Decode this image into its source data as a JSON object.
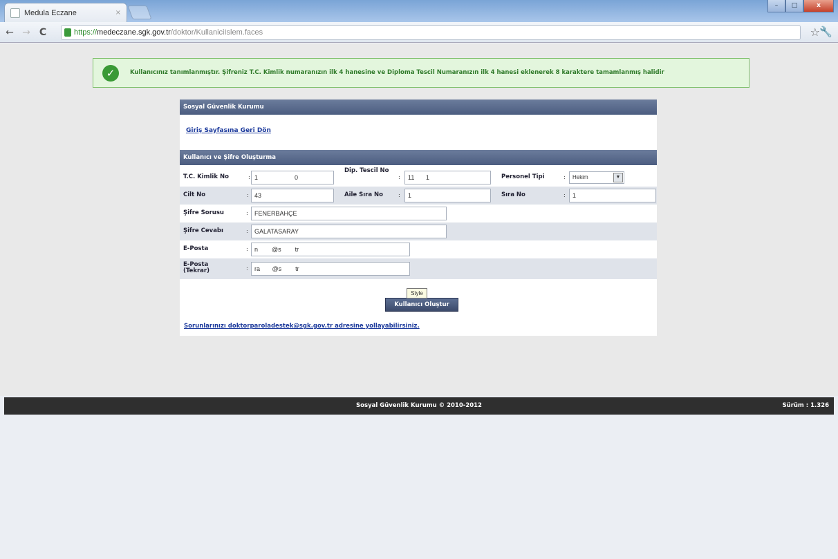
{
  "browser": {
    "tab_title": "Medula Eczane",
    "tab_close": "×",
    "url_scheme": "https://",
    "url_host": "medeczane.sgk.gov.tr",
    "url_path": "/doktor/KullaniciIslem.faces",
    "back": "←",
    "forward": "→",
    "reload": "C",
    "star": "☆",
    "wrench": "🔧",
    "win_min": "–",
    "win_max": "□",
    "win_close": "x"
  },
  "message": {
    "check": "✓",
    "text": "Kullanıcınız tanımlanmıştır. Şifreniz T.C. Kimlik numaranızın ilk 4 hanesine ve Diploma Tescil Numaranızın ilk 4 hanesi eklenerek 8 karaktere tamamlanmış halidir"
  },
  "panel": {
    "header": "Sosyal Güvenlik Kurumu",
    "back_link": "Giriş Sayfasına Geri Dön",
    "section_header": "Kullanıcı ve Şifre Oluşturma"
  },
  "form": {
    "colon": ":",
    "tc_label": "T.C. Kimlik No",
    "tc_value_1": "1",
    "tc_value_2": "0",
    "dip_label": "Dip. Tescil No",
    "dip_value_1": "11",
    "dip_value_2": "1",
    "personel_label": "Personel Tipi",
    "personel_value": "Hekim",
    "cilt_label": "Cilt No",
    "cilt_value": "43",
    "aile_label": "Aile Sıra No",
    "aile_value": "1",
    "sira_label": "Sıra No",
    "sira_value": "1",
    "soru_label": "Şifre Sorusu",
    "soru_value": "FENERBAHÇE",
    "cevap_label": "Şifre Cevabı",
    "cevap_value": "GALATASARAY",
    "eposta_label": "E-Posta",
    "eposta_value": "n        @s        tr",
    "eposta2_label": "E-Posta (Tekrar)",
    "eposta2_value": "ra       @s        tr",
    "tooltip": "Style",
    "submit": "Kullanıcı Oluştur",
    "help": "Sorunlarınızı doktorparoladestek@sgk.gov.tr adresine yollayabilirsiniz."
  },
  "footer": {
    "copyright": "Sosyal Güvenlik Kurumu © 2010-2012",
    "version": "Sürüm : 1.326"
  }
}
